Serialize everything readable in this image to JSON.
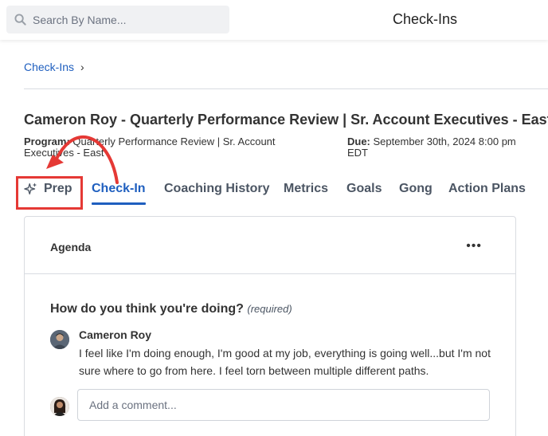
{
  "header": {
    "search_placeholder": "Search By Name...",
    "title": "Check-Ins"
  },
  "breadcrumb": {
    "items": [
      "Check-Ins"
    ],
    "separator": "›"
  },
  "checkin": {
    "title": "Cameron Roy - Quarterly Performance Review | Sr. Account Executives - East",
    "program_label": "Program:",
    "program_value": "Quarterly Performance Review | Sr. Account Executives - East",
    "due_label": "Due:",
    "due_value": "September 30th, 2024 8:00 pm EDT"
  },
  "tabs": [
    {
      "label": "Prep",
      "icon": "sparkle-icon",
      "active": false
    },
    {
      "label": "Check-In",
      "active": true
    },
    {
      "label": "Coaching History",
      "active": false
    },
    {
      "label": "Metrics",
      "active": false
    },
    {
      "label": "Goals",
      "active": false
    },
    {
      "label": "Gong",
      "active": false
    },
    {
      "label": "Action Plans",
      "active": false
    }
  ],
  "agenda": {
    "title": "Agenda",
    "more_label": "•••",
    "question": "How do you think you're doing?",
    "required_label": "(required)",
    "response": {
      "author": "Cameron Roy",
      "text": "I feel like I'm doing enough, I'm good at my job, everything is going well...but I'm not sure where to go from here. I feel torn between multiple different paths."
    },
    "comment_placeholder": "Add a comment..."
  },
  "colors": {
    "accent": "#1f5fbf",
    "annotation": "#e53935",
    "text": "#333333"
  }
}
